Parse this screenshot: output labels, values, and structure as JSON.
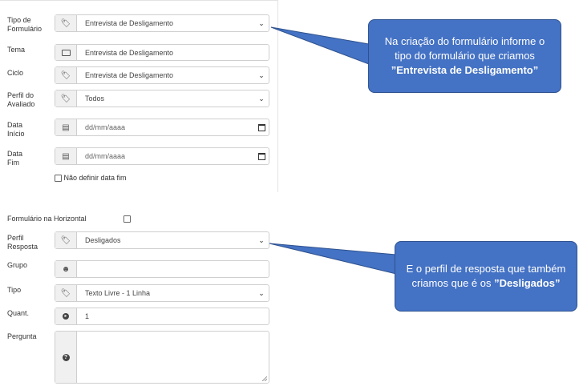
{
  "form_top": {
    "tipo_formulario": {
      "label": "Tipo de Formulário",
      "value": "Entrevista de Desligamento"
    },
    "tema": {
      "label": "Tema",
      "value": "Entrevista de Desligamento"
    },
    "ciclo": {
      "label": "Ciclo",
      "value": "Entrevista de Desligamento"
    },
    "perfil_avaliado": {
      "label": "Perfil do Avaliado",
      "value": "Todos"
    },
    "data_inicio": {
      "label": "Data Início",
      "placeholder": "dd/mm/aaaa"
    },
    "data_fim": {
      "label": "Data Fim",
      "placeholder": "dd/mm/aaaa"
    },
    "nao_definir": {
      "label": "Não definir data fim"
    }
  },
  "form_bottom": {
    "horizontal": {
      "label": "Formulário na Horizontal"
    },
    "perfil_resposta": {
      "label": "Perfil Resposta",
      "value": "Desligados"
    },
    "grupo": {
      "label": "Grupo",
      "value": ""
    },
    "tipo": {
      "label": "Tipo",
      "value": "Texto Livre - 1 Linha"
    },
    "quant": {
      "label": "Quant.",
      "value": "1"
    },
    "pergunta": {
      "label": "Pergunta",
      "value": ""
    }
  },
  "callouts": {
    "first": {
      "pre": "Na criação do formulário informe o tipo do formulário que criamos ",
      "bold": "”Entrevista de Desligamento”"
    },
    "second": {
      "pre": "E o perfil de resposta que também criamos que é os ",
      "bold": "”Desligados”"
    }
  },
  "colors": {
    "callout": "#4472c4",
    "callout_border": "#2f528f"
  }
}
